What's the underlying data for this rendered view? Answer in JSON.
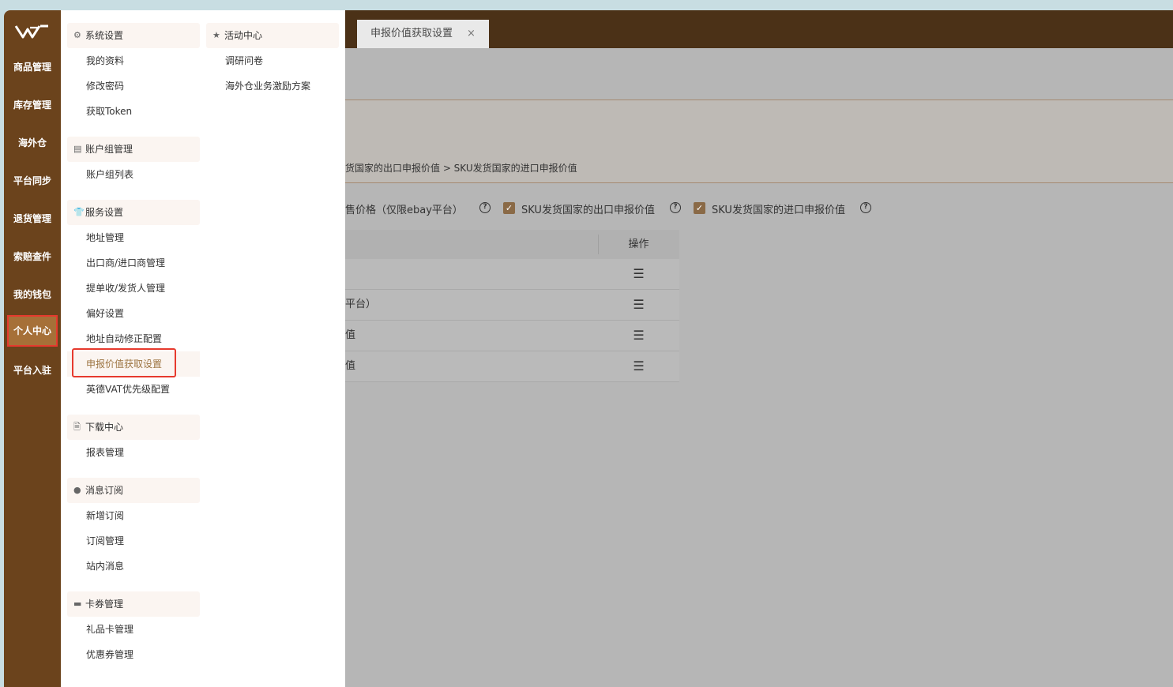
{
  "nav": {
    "items": [
      {
        "label": "商品管理"
      },
      {
        "label": "库存管理"
      },
      {
        "label": "海外仓"
      },
      {
        "label": "平台同步"
      },
      {
        "label": "退货管理"
      },
      {
        "label": "索赔查件"
      },
      {
        "label": "我的钱包"
      },
      {
        "label": "个人中心"
      },
      {
        "label": "平台入驻"
      }
    ],
    "active": "个人中心"
  },
  "tabs": [
    {
      "label": "申报价值获取设置",
      "close": "×"
    }
  ],
  "breadcrumb": "货国家的出口申报价值 > SKU发货国家的进口申报价值",
  "checks": [
    {
      "label": "售价格（仅限ebay平台）",
      "checked": false
    },
    {
      "label": "SKU发货国家的出口申报价值",
      "checked": true
    },
    {
      "label": "SKU发货国家的进口申报价值",
      "checked": true
    }
  ],
  "table": {
    "op_header": "操作",
    "rows": [
      {
        "text": ""
      },
      {
        "text": "平台）"
      },
      {
        "text": "值"
      },
      {
        "text": "值"
      }
    ]
  },
  "menu": {
    "col1": [
      {
        "title": "系统设置",
        "icon": "gear-icon",
        "items": [
          "我的资料",
          "修改密码",
          "获取Token"
        ]
      },
      {
        "title": "账户组管理",
        "icon": "list-icon",
        "items": [
          "账户组列表"
        ]
      },
      {
        "title": "服务设置",
        "icon": "shirt-icon",
        "items": [
          "地址管理",
          "出口商/进口商管理",
          "提单收/发货人管理",
          "偏好设置",
          "地址自动修正配置",
          "申报价值获取设置",
          "英德VAT优先级配置"
        ]
      },
      {
        "title": "下载中心",
        "icon": "download-icon",
        "items": [
          "报表管理"
        ]
      },
      {
        "title": "消息订阅",
        "icon": "chat-icon",
        "items": [
          "新增订阅",
          "订阅管理",
          "站内消息"
        ]
      },
      {
        "title": "卡券管理",
        "icon": "card-icon",
        "items": [
          "礼品卡管理",
          "优惠券管理"
        ]
      }
    ],
    "col2": [
      {
        "title": "活动中心",
        "icon": "star-icon",
        "items": [
          "调研问卷",
          "海外仓业务激励方案"
        ]
      }
    ],
    "selected": "申报价值获取设置"
  },
  "glyphs": {
    "check": "✓",
    "help": "?",
    "hamburger": "☰"
  }
}
